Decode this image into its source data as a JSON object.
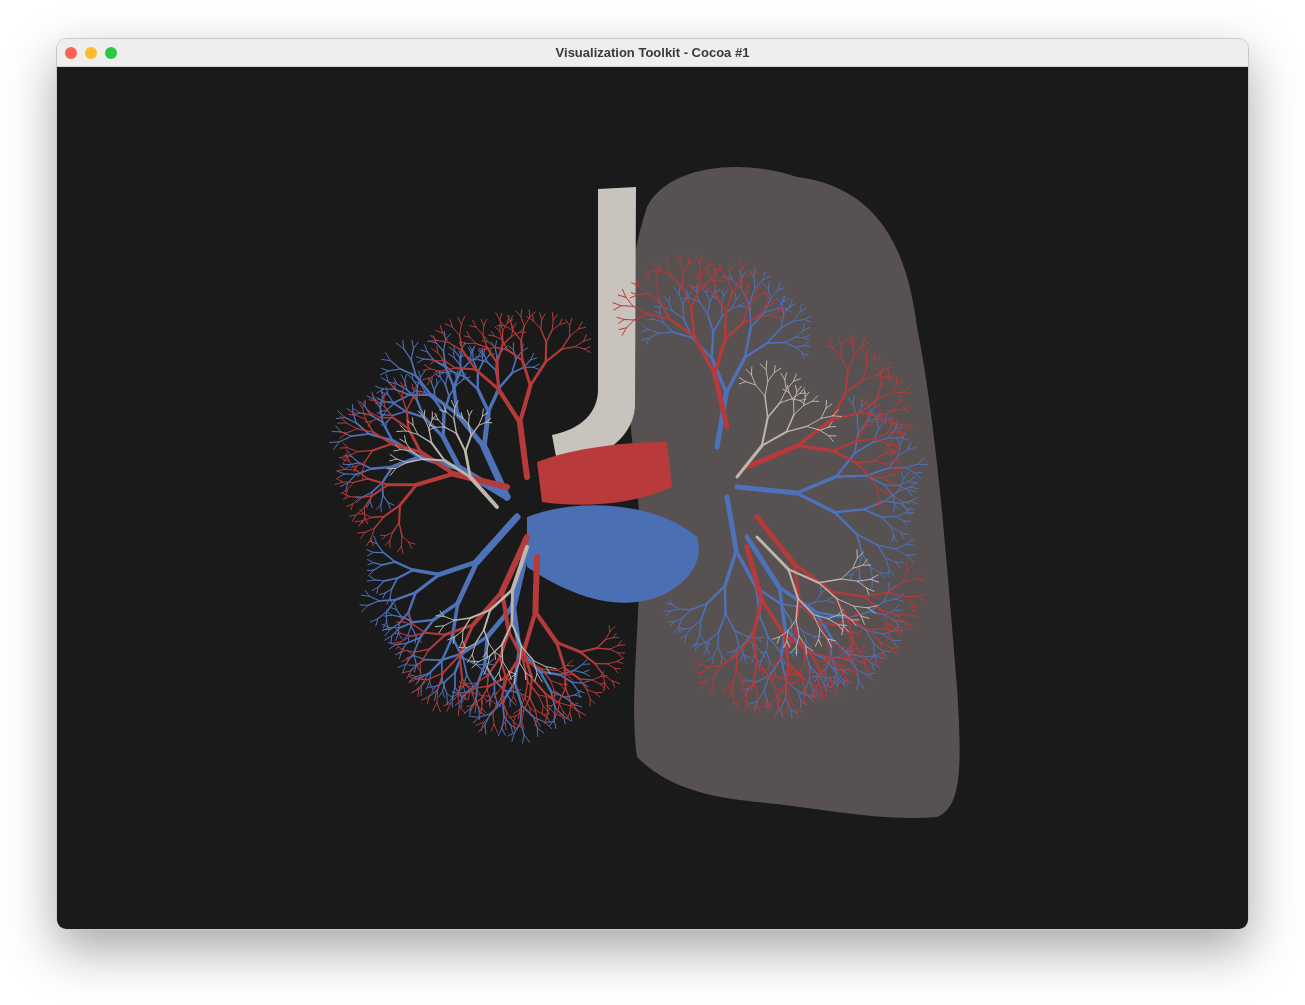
{
  "window": {
    "title": "Visualization Toolkit - Cocoa #1"
  }
}
